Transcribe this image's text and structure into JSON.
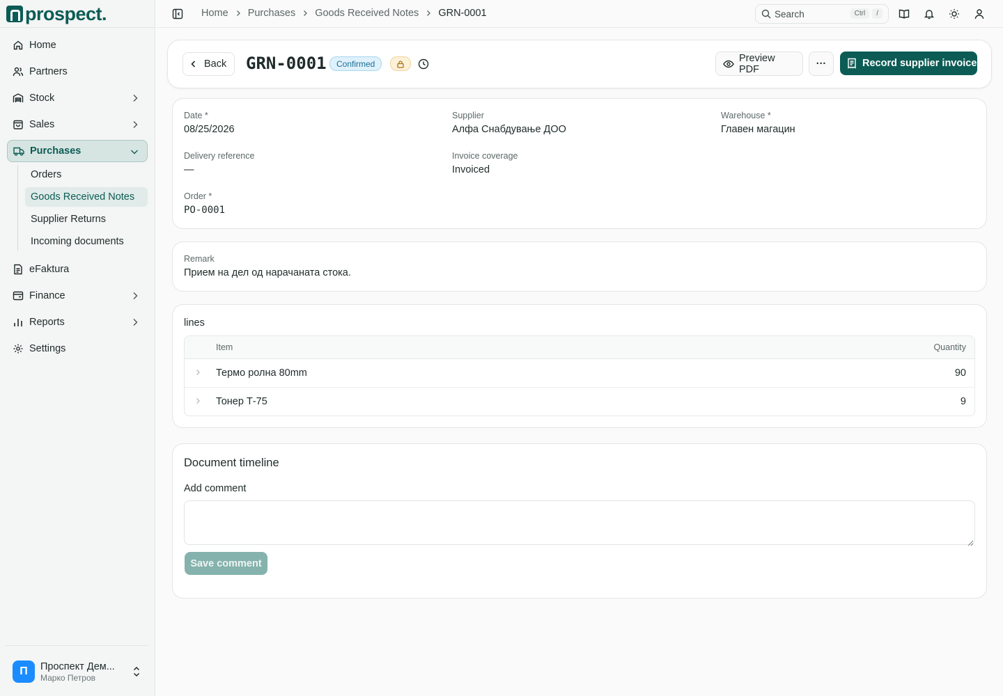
{
  "brand": {
    "name": "prospect."
  },
  "sidebar": {
    "items": [
      {
        "label": "Home"
      },
      {
        "label": "Partners"
      },
      {
        "label": "Stock"
      },
      {
        "label": "Sales"
      },
      {
        "label": "Purchases"
      },
      {
        "label": "eFaktura"
      },
      {
        "label": "Finance"
      },
      {
        "label": "Reports"
      },
      {
        "label": "Settings"
      }
    ],
    "purchases_sub": [
      {
        "label": "Orders"
      },
      {
        "label": "Goods Received Notes"
      },
      {
        "label": "Supplier Returns"
      },
      {
        "label": "Incoming documents"
      }
    ],
    "user": {
      "initial": "П",
      "name": "Проспект Дем...",
      "person": "Марко Петров"
    }
  },
  "topbar": {
    "breadcrumb": [
      "Home",
      "Purchases",
      "Goods Received Notes",
      "GRN-0001"
    ],
    "search_label": "Search",
    "search_kbd": [
      "Ctrl",
      "/"
    ]
  },
  "header": {
    "back_label": "Back",
    "title": "GRN-0001",
    "status": "Confirmed",
    "preview_label": "Preview PDF",
    "more_label": "···",
    "primary_label": "Record supplier invoice"
  },
  "details": {
    "date_label": "Date *",
    "date_value": "08/25/2026",
    "supplier_label": "Supplier",
    "supplier_value": "Алфа Снабдување ДОО",
    "warehouse_label": "Warehouse *",
    "warehouse_value": "Главен магацин",
    "delivery_label": "Delivery reference",
    "delivery_value": "—",
    "coverage_label": "Invoice coverage",
    "coverage_value": "Invoiced",
    "order_label": "Order *",
    "order_value": "PO-0001"
  },
  "remark": {
    "label": "Remark",
    "value": "Прием на дел од нарачаната стока."
  },
  "lines": {
    "title": "lines",
    "columns": {
      "item": "Item",
      "quantity": "Quantity"
    },
    "rows": [
      {
        "item": "Термо ролна 80mm",
        "quantity": "90"
      },
      {
        "item": "Тонер Т-75",
        "quantity": "9"
      }
    ]
  },
  "timeline": {
    "title": "Document timeline",
    "comment_label": "Add comment",
    "comment_value": "",
    "save_label": "Save comment"
  },
  "colors": {
    "accent": "#0c5c55",
    "badge_bg": "#dff1fb",
    "badge_text": "#1b6f94",
    "lock_bg": "#fdf1d8",
    "avatar": "#1a8cff"
  }
}
